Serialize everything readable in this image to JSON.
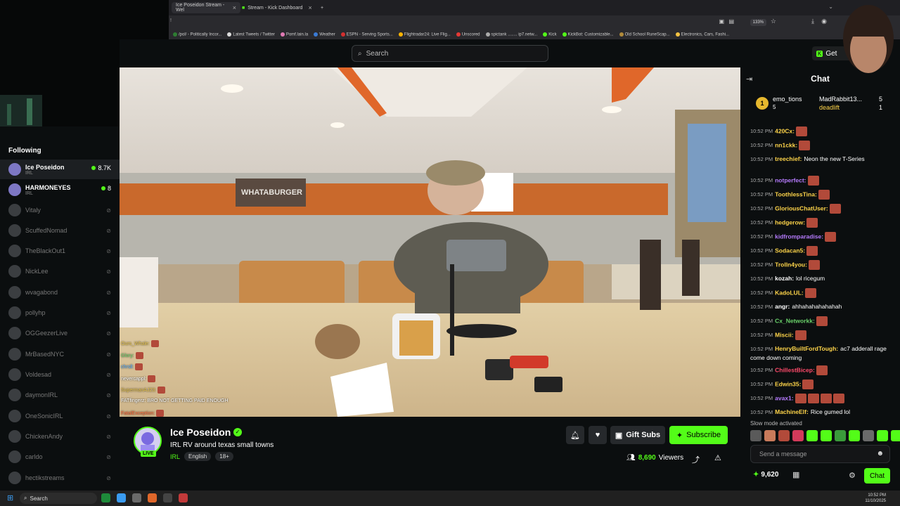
{
  "browser": {
    "tabs": [
      {
        "label": "Ice Poseidon Stream - Wel",
        "active": true
      },
      {
        "label": "Stream - Kick Dashboard",
        "active": false
      }
    ],
    "new_tab": "+",
    "zoom": "133%",
    "bookmarks": [
      "/pol/ - Politically Incor...",
      "Latest Tweets / Twitter",
      "Pomf.lain.la",
      "Weather",
      "ESPN - Serving Sports...",
      "Flightradar24: Live Flig...",
      "Unscored",
      "spictank ........ ip7.netw...",
      "Kick",
      "KickBot: Customizable...",
      "Old School RuneScap...",
      "Electronics, Cars, Fashi..."
    ]
  },
  "header": {
    "search_placeholder": "Search",
    "get_label": "Get"
  },
  "sidebar": {
    "title": "Following",
    "items": [
      {
        "name": "Ice Poseidon",
        "category": "IRL",
        "count": "8.7K",
        "live": true
      },
      {
        "name": "HARMONEYES",
        "category": "IRL",
        "count": "8",
        "live": true
      },
      {
        "name": "Vitaly",
        "live": false
      },
      {
        "name": "ScuffedNomad",
        "live": false
      },
      {
        "name": "TheBlackOut1",
        "live": false
      },
      {
        "name": "NickLee",
        "live": false
      },
      {
        "name": "wvagabond",
        "live": false
      },
      {
        "name": "pollyhp",
        "live": false
      },
      {
        "name": "OGGeezerLive",
        "live": false
      },
      {
        "name": "MrBasedNYC",
        "live": false
      },
      {
        "name": "Voldesad",
        "live": false
      },
      {
        "name": "daymonIRL",
        "live": false
      },
      {
        "name": "OneSonicIRL",
        "live": false
      },
      {
        "name": "ChickenAndy",
        "live": false
      },
      {
        "name": "carldo",
        "live": false
      },
      {
        "name": "hectikstreams",
        "live": false
      }
    ]
  },
  "video": {
    "sign_text": "WHATABURGER",
    "overlay_chat": [
      {
        "user": "Ours_Whale:",
        "color": "#e6c34a"
      },
      {
        "user": "Glory:",
        "color": "#6ad26a"
      },
      {
        "user": "chrsll:",
        "color": "#5ab0ff"
      },
      {
        "user": "nevercappl:",
        "color": "#ffffff"
      },
      {
        "user": "SupermanAJ23:",
        "color": "#e6c34a"
      },
      {
        "user": "FATfingerz:",
        "text": "BRO NOT GETTING PAID ENOUGH",
        "color": "#ffffff"
      },
      {
        "user": "FatalException:",
        "color": "#ff6a3a"
      }
    ]
  },
  "stream": {
    "channel_name": "Ice Poseidon",
    "live_badge": "LIVE",
    "title": "IRL RV around texas small towns",
    "category": "IRL",
    "tags": [
      "English",
      "18+"
    ],
    "gift_label": "Gift Subs",
    "subscribe_label": "Subscribe",
    "viewer_count": "8,690",
    "viewer_label": "Viewers"
  },
  "chat": {
    "title": "Chat",
    "leaderboard": [
      {
        "rank": "1",
        "user": "emo_tions",
        "count": "5"
      },
      {
        "user": "MadRabbit13...",
        "count": "5"
      },
      {
        "user": "deadlift",
        "count": "1"
      }
    ],
    "messages": [
      {
        "time": "10:52 PM",
        "user": "420Cx:",
        "color": "#ffd54a",
        "text": "",
        "emotes": 1
      },
      {
        "time": "10:52 PM",
        "user": "nn1ckk:",
        "color": "#ffd54a",
        "text": "",
        "emotes": 1
      },
      {
        "time": "10:52 PM",
        "user": "treechief:",
        "color": "#ffd54a",
        "text": "Neon the new T-Series",
        "emotes": 0
      },
      {
        "time": "10:52 PM",
        "user": "notperfect:",
        "color": "#b67bff",
        "text": "",
        "emotes": 1
      },
      {
        "time": "10:52 PM",
        "user": "ToothlessTina:",
        "color": "#ffd54a",
        "text": "",
        "emotes": 1
      },
      {
        "time": "10:52 PM",
        "user": "GloriousChatUser:",
        "color": "#ffd54a",
        "text": "",
        "emotes": 1
      },
      {
        "time": "10:52 PM",
        "user": "hedgerow:",
        "color": "#ffd54a",
        "text": "",
        "emotes": 1
      },
      {
        "time": "10:52 PM",
        "user": "kidfromparadise:",
        "color": "#b67bff",
        "text": "",
        "emotes": 1
      },
      {
        "time": "10:52 PM",
        "user": "Sodacan5:",
        "color": "#ffd54a",
        "text": "",
        "emotes": 1
      },
      {
        "time": "10:52 PM",
        "user": "Trolln4you:",
        "color": "#ffd54a",
        "text": "",
        "emotes": 1
      },
      {
        "time": "10:52 PM",
        "user": "kozah:",
        "color": "#ffffff",
        "text": "lol ricegum",
        "emotes": 0
      },
      {
        "time": "10:52 PM",
        "user": "KadoLUL:",
        "color": "#ffd54a",
        "text": "",
        "emotes": 1
      },
      {
        "time": "10:52 PM",
        "user": "angr:",
        "color": "#ffffff",
        "text": "ahhahahahahahah",
        "emotes": 0
      },
      {
        "time": "10:52 PM",
        "user": "Cx_Networkk:",
        "color": "#6ad26a",
        "text": "",
        "emotes": 1
      },
      {
        "time": "10:52 PM",
        "user": "Miscii:",
        "color": "#ffd54a",
        "text": "",
        "emotes": 1
      },
      {
        "time": "10:52 PM",
        "user": "HenryBuiltFordTough:",
        "color": "#ffd54a",
        "text": "ac7 adderall rage come down coming",
        "emotes": 0
      },
      {
        "time": "10:52 PM",
        "user": "ChillestBicep:",
        "color": "#ff4a6a",
        "text": "",
        "emotes": 1
      },
      {
        "time": "10:52 PM",
        "user": "Edwin35:",
        "color": "#ffd54a",
        "text": "",
        "emotes": 1
      },
      {
        "time": "10:52 PM",
        "user": "avax1:",
        "color": "#b67bff",
        "text": "",
        "emotes": 4
      },
      {
        "time": "10:52 PM",
        "user": "MachineElf:",
        "color": "#ffd54a",
        "text": "Rice gumed lol",
        "emotes": 0
      }
    ],
    "slow_mode": "Slow mode activated",
    "input_placeholder": "Send a message",
    "points": "9,620",
    "send_label": "Chat"
  },
  "taskbar": {
    "search_placeholder": "Search",
    "time": "10:52 PM",
    "date": "11/10/2025"
  },
  "colors": {
    "accent": "#53fc18",
    "background": "#0b0e0f"
  }
}
